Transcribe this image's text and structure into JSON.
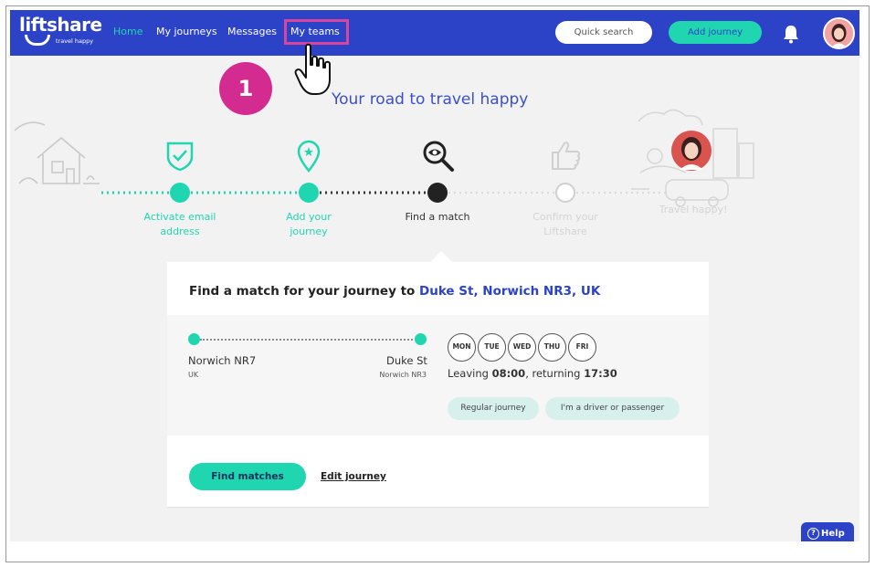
{
  "nav": {
    "logo_text": "liftshare",
    "logo_tagline": "travel happy",
    "links": [
      "Home",
      "My journeys",
      "Messages",
      "My teams"
    ],
    "active_link": "Home",
    "highlighted_link": "My teams",
    "quick_search": "Quick search",
    "add_journey": "Add journey"
  },
  "annotation": {
    "step_number": "1"
  },
  "hero": {
    "title": "Your road to travel happy"
  },
  "progress": {
    "steps": [
      {
        "label_line1": "Activate email",
        "label_line2": "address",
        "state": "done",
        "icon": "shield-check-icon"
      },
      {
        "label_line1": "Add your",
        "label_line2": "journey",
        "state": "done",
        "icon": "location-pin-icon"
      },
      {
        "label_line1": "Find a match",
        "label_line2": "",
        "state": "current",
        "icon": "magnifier-icon"
      },
      {
        "label_line1": "Confirm your",
        "label_line2": "Liftshare",
        "state": "todo",
        "icon": "thumbs-up-icon"
      },
      {
        "label_line1": "Travel happy!",
        "label_line2": "",
        "state": "todo",
        "icon": "avatar-car-icon"
      }
    ]
  },
  "card": {
    "title_prefix": "Find a match for your journey to",
    "destination": "Duke St, Norwich NR3, UK",
    "origin_main": "Norwich NR7",
    "origin_sub": "UK",
    "dest_main": "Duke St",
    "dest_sub": "Norwich NR3",
    "days": [
      "MON",
      "TUE",
      "WED",
      "THU",
      "FRI"
    ],
    "leaving_label": "Leaving",
    "leaving_time": "08:00",
    "returning_label": ", returning",
    "returning_time": "17:30",
    "tags": [
      "Regular journey",
      "I'm a driver or passenger"
    ],
    "find_button": "Find matches",
    "edit_link": "Edit journey"
  },
  "help": {
    "label": "Help",
    "icon_glyph": "?"
  },
  "colors": {
    "nav_blue": "#2c43c8",
    "accent_teal": "#1fd6b0",
    "annotation_pink": "#d32b8f",
    "highlight_pink": "#d9449c"
  }
}
